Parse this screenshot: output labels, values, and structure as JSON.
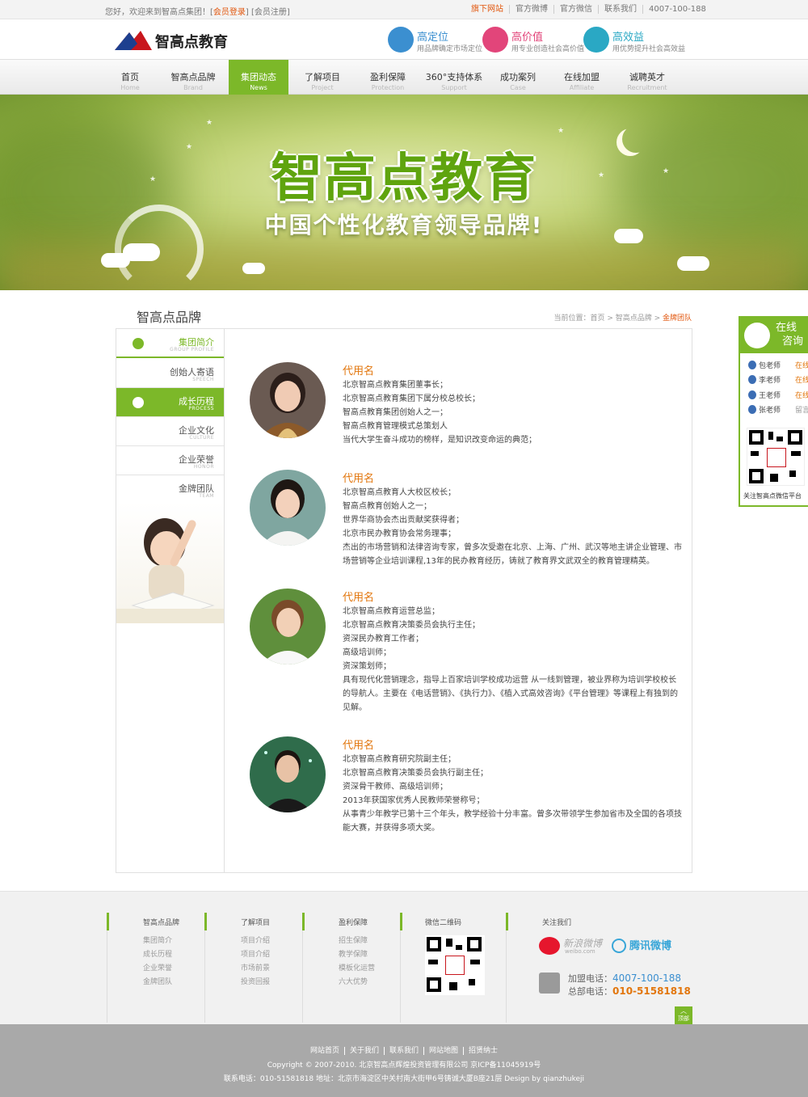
{
  "topbar": {
    "welcome": "您好，欢迎来到智高点集团！[",
    "login": "会员登录",
    "sep": "] [",
    "register": "会员注册",
    "end": "]",
    "links": [
      "旗下网站",
      "官方微博",
      "官方微信",
      "联系我们",
      "4007-100-188"
    ]
  },
  "header": {
    "logo": "智高点教育",
    "features": [
      {
        "title": "高定位",
        "sub": "用品牌确定市场定位",
        "color": "#3b8fd0"
      },
      {
        "title": "高价值",
        "sub": "用专业创造社会高价值",
        "color": "#e2457a"
      },
      {
        "title": "高效益",
        "sub": "用优势提升社会高效益",
        "color": "#2aa8c4"
      }
    ]
  },
  "nav": [
    {
      "zh": "首页",
      "en": "Home"
    },
    {
      "zh": "智高点品牌",
      "en": "Brand"
    },
    {
      "zh": "集团动态",
      "en": "News"
    },
    {
      "zh": "了解项目",
      "en": "Project"
    },
    {
      "zh": "盈利保障",
      "en": "Protection"
    },
    {
      "zh": "360°支持体系",
      "en": "Support"
    },
    {
      "zh": "成功案列",
      "en": "Case"
    },
    {
      "zh": "在线加盟",
      "en": "Affiliate"
    },
    {
      "zh": "诚聘英才",
      "en": "Recruitment"
    }
  ],
  "banner": {
    "title": "智高点教育",
    "slogan": "中国个性化教育领导品牌!"
  },
  "section": {
    "title": "智高点品牌",
    "crumb_prefix": "当前位置：首页 > 智高点品牌 > ",
    "crumb_current": "金牌团队"
  },
  "sidebar": [
    {
      "zh": "集团简介",
      "en": "GROUP PROFILE"
    },
    {
      "zh": "创始人寄语",
      "en": "SPEECH"
    },
    {
      "zh": "成长历程",
      "en": "PROCESS"
    },
    {
      "zh": "企业文化",
      "en": "CULTURE"
    },
    {
      "zh": "企业荣誉",
      "en": "HONOR"
    },
    {
      "zh": "金牌团队",
      "en": "TEAM"
    }
  ],
  "people": [
    {
      "name": "代用名",
      "lines": [
        "北京智高点教育集团董事长；",
        "北京智高点教育集团下属分校总校长；",
        "智高点教育集团创始人之一；",
        "智高点教育管理模式总策划人",
        "当代大学生奋斗成功的榜样，是知识改变命运的典范；"
      ]
    },
    {
      "name": "代用名",
      "lines": [
        "北京智高点教育人大校区校长；",
        "智高点教育创始人之一；",
        "世界华商协会杰出贡献奖获得者；",
        "北京市民办教育协会常务理事；",
        "杰出的市场营销和法律咨询专家，曾多次受邀在北京、上海、广州、武汉等地主讲企业管理、市场营销等企业培训课程,13年的民办教育经历，铸就了教育界文武双全的教育管理精英。"
      ]
    },
    {
      "name": "代用名",
      "lines": [
        "北京智高点教育运营总监；",
        "北京智高点教育决策委员会执行主任；",
        "资深民办教育工作者；",
        "高级培训师；",
        "资深策划师；",
        "具有现代化营销理念，指导上百家培训学校成功运营 从一线到管理，被业界称为培训学校校长的导航人。主要在《电话营销》、《执行力》、《植入式高效咨询》《平台管理》等课程上有独到的见解。"
      ]
    },
    {
      "name": "代用名",
      "lines": [
        "北京智高点教育研究院副主任；",
        "北京智高点教育决策委员会执行副主任；",
        "资深骨干教师、高级培训师；",
        "2013年获国家优秀人民教师荣誉称号；",
        "从事青少年教学已第十三个年头，教学经验十分丰富。曾多次带领学生参加省市及全国的各项技能大赛，并获得多项大奖。"
      ]
    }
  ],
  "footer": {
    "cols": [
      {
        "h": "智高点品牌",
        "items": [
          "集团简介",
          "成长历程",
          "企业荣誉",
          "金牌团队"
        ]
      },
      {
        "h": "了解项目",
        "items": [
          "项目介绍",
          "项目介绍",
          "市场前景",
          "投资回报"
        ]
      },
      {
        "h": "盈利保障",
        "items": [
          "招生保障",
          "教学保障",
          "模板化运营",
          "六大优势"
        ]
      }
    ],
    "wechat_title": "微信二维码",
    "follow_title": "关注我们",
    "sina": "新浪微博",
    "sina_en": "weibo.com",
    "tencent": "腾讯微博",
    "phone1_label": "加盟电话：",
    "phone1": "4007-100-188",
    "phone2_label": "总部电话：",
    "phone2": "010-51581818",
    "top": "顶部"
  },
  "bottom": {
    "links": [
      "网站首页",
      "关于我们",
      "联系我们",
      "网站地图",
      "招贤纳士"
    ],
    "copy": "Copyright © 2007-2010. 北京智高点辉煌投资管理有限公司   京ICP备11045919号",
    "addr": "联系电话：010-51581818     地址：北京市海淀区中关村南大街甲6号铸诚大厦B座21层   Design by qianzhukeji"
  },
  "float": {
    "title1": "在线",
    "title2": "咨询",
    "agents": [
      {
        "n": "包老师",
        "s": "在线"
      },
      {
        "n": "李老师",
        "s": "在线"
      },
      {
        "n": "王老师",
        "s": "在线"
      },
      {
        "n": "张老师",
        "s": "留言"
      }
    ],
    "qr_caption": "关注智高点微信平台"
  }
}
